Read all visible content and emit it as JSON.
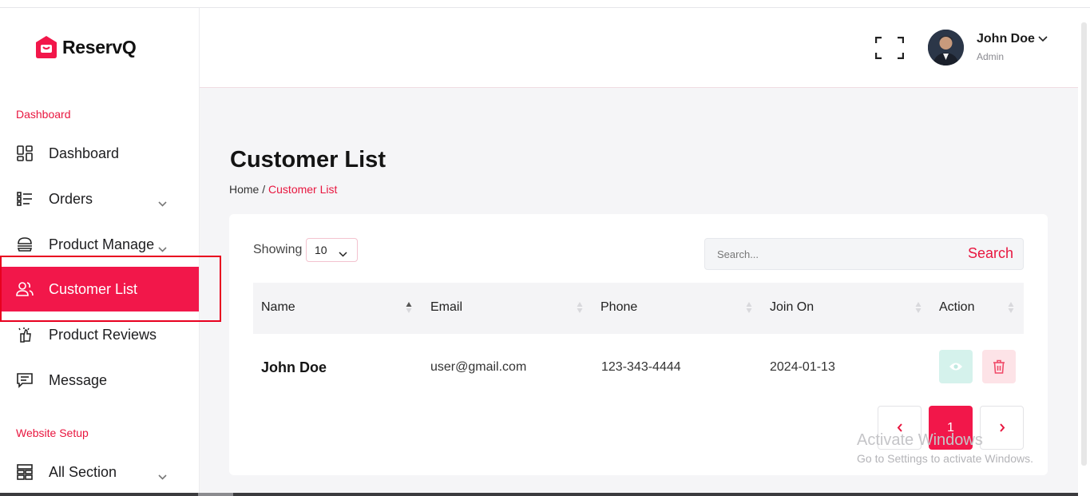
{
  "brand": {
    "name": "ReservQ",
    "accent": "#f2174a"
  },
  "sidebar": {
    "section_main": "Dashboard",
    "items": [
      {
        "label": "Dashboard",
        "icon": "dashboard-grid-icon"
      },
      {
        "label": "Orders",
        "icon": "list-icon",
        "has_children": true
      },
      {
        "label": "Product Manage",
        "icon": "burger-icon",
        "has_children": true
      },
      {
        "label": "Customer List",
        "icon": "users-icon",
        "active": true
      },
      {
        "label": "Product Reviews",
        "icon": "reviews-icon"
      },
      {
        "label": "Message",
        "icon": "message-icon"
      }
    ],
    "section_website": "Website Setup",
    "website_items": [
      {
        "label": "All Section",
        "icon": "sections-icon",
        "has_children": true
      }
    ]
  },
  "header": {
    "user_name": "John Doe",
    "user_role": "Admin"
  },
  "page": {
    "title": "Customer List",
    "breadcrumb": {
      "home": "Home",
      "separator": "/",
      "current": "Customer List"
    }
  },
  "table": {
    "showing_label": "Showing",
    "page_size": "10",
    "search_placeholder": "Search...",
    "search_button": "Search",
    "columns": [
      "Name",
      "Email",
      "Phone",
      "Join On",
      "Action"
    ],
    "rows": [
      {
        "name": "John Doe",
        "email": "user@gmail.com",
        "phone": "123-343-4444",
        "join_on": "2024-01-13"
      }
    ],
    "pagination": {
      "current": "1"
    }
  },
  "os_watermark": {
    "line1": "Activate Windows",
    "line2": "Go to Settings to activate Windows."
  }
}
